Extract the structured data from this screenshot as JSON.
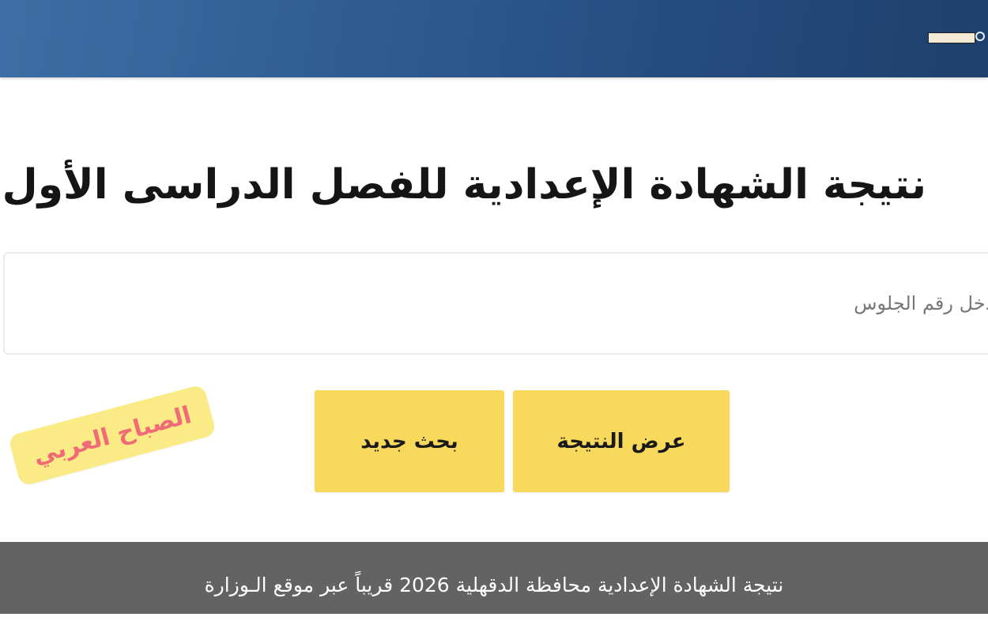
{
  "header": {
    "title": "نتيجة الشهادة الإعدادية للفصل الدراسى الأول"
  },
  "form": {
    "seat_number_placeholder": "أدخل رقم الجلوس",
    "show_result_label": "عرض النتيجة",
    "new_search_label": "بحث جديد",
    "button_color": "#f9d95c"
  },
  "watermark": {
    "text": "الصباح العربي"
  },
  "caption": {
    "text": "نتيجة الشهادة الإعدادية محافظة الدقهلية 2026 قريباً عبر موقع الـوزارة"
  },
  "colors": {
    "banner": "#2f5d92",
    "caption_bar": "#636363",
    "watermark_bg": "#faeb86",
    "watermark_text": "#f06a78"
  }
}
